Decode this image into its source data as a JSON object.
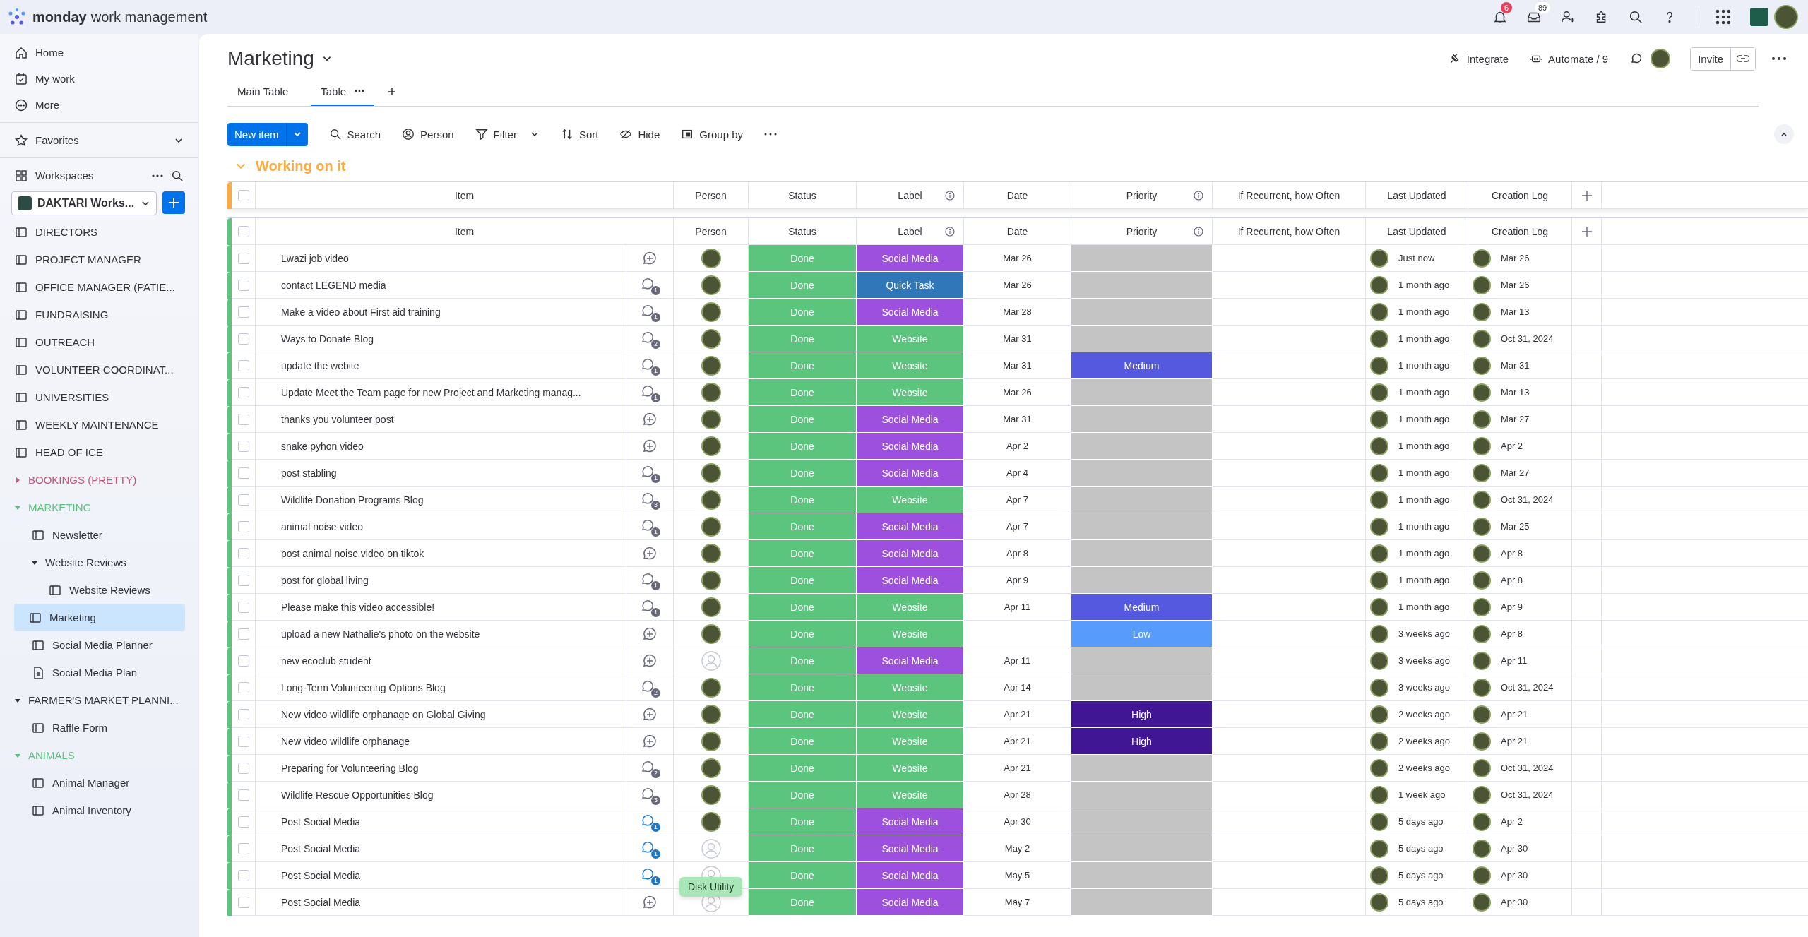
{
  "topbar": {
    "brand": "monday",
    "product": "work management",
    "notifications_badge": "6",
    "inbox_badge": "89"
  },
  "sidebar": {
    "nav": [
      {
        "kind": "home",
        "label": "Home"
      },
      {
        "kind": "my_work",
        "label": "My work"
      },
      {
        "kind": "more",
        "label": "More"
      }
    ],
    "favorites": "Favorites",
    "workspaces": "Workspaces",
    "workspace": "DAKTARI Works...",
    "tree": [
      {
        "kind": "board",
        "label": "DIRECTORS",
        "selected": false
      },
      {
        "kind": "board",
        "label": "PROJECT MANAGER",
        "selected": false
      },
      {
        "kind": "board",
        "label": "OFFICE MANAGER (PATIE...",
        "selected": false
      },
      {
        "kind": "board",
        "label": "FUNDRAISING",
        "selected": false
      },
      {
        "kind": "board",
        "label": "OUTREACH",
        "selected": false
      },
      {
        "kind": "board",
        "label": "VOLUNTEER COORDINAT...",
        "selected": false
      },
      {
        "kind": "board",
        "label": "UNIVERSITIES",
        "selected": false
      },
      {
        "kind": "board",
        "label": "WEEKLY MAINTENANCE",
        "selected": false
      },
      {
        "kind": "board",
        "label": "HEAD OF ICE",
        "selected": false
      },
      {
        "kind": "folder",
        "label": "BOOKINGS (PRETTY)",
        "color": "#c9547a",
        "expanded": false
      },
      {
        "kind": "folder",
        "label": "MARKETING",
        "color": "#5ac47d",
        "expanded": true,
        "children": [
          {
            "kind": "board",
            "label": "Newsletter",
            "selected": false
          },
          {
            "kind": "folder",
            "label": "Website Reviews",
            "color": "#323338",
            "expanded": true,
            "children": [
              {
                "kind": "board",
                "label": "Website Reviews",
                "selected": false
              }
            ]
          },
          {
            "kind": "board",
            "label": "Marketing",
            "selected": true
          },
          {
            "kind": "board",
            "label": "Social Media Planner",
            "selected": false
          },
          {
            "kind": "doc",
            "label": "Social Media Plan",
            "selected": false
          }
        ]
      },
      {
        "kind": "folder",
        "label": "FARMER'S MARKET PLANNI...",
        "color": "#323338",
        "expanded": true,
        "children": [
          {
            "kind": "board",
            "label": "Raffle Form",
            "selected": false
          }
        ]
      },
      {
        "kind": "folder",
        "label": "ANIMALS",
        "color": "#5ac47d",
        "expanded": true,
        "children": [
          {
            "kind": "board",
            "label": "Animal Manager",
            "selected": false
          },
          {
            "kind": "board",
            "label": "Animal Inventory",
            "selected": false
          }
        ]
      }
    ]
  },
  "board": {
    "title": "Marketing",
    "tabs": [
      {
        "label": "Main Table",
        "selected": false
      },
      {
        "label": "Table",
        "selected": true
      }
    ],
    "integrate": "Integrate",
    "automate": "Automate / 9",
    "invite": "Invite"
  },
  "toolbar": {
    "new_item": "New item",
    "tools": [
      {
        "kind": "search",
        "label": "Search"
      },
      {
        "kind": "person",
        "label": "Person"
      },
      {
        "kind": "filter",
        "label": "Filter"
      },
      {
        "kind": "sort",
        "label": "Sort"
      },
      {
        "kind": "hide",
        "label": "Hide"
      },
      {
        "kind": "group",
        "label": "Group by"
      }
    ]
  },
  "groups": [
    {
      "title": "Working on it",
      "color": "#fdab3d",
      "all_checked": false,
      "columns": [
        {
          "title": "Item",
          "info": false
        },
        {
          "title": "Person",
          "info": false
        },
        {
          "title": "Status",
          "info": false
        },
        {
          "title": "Label",
          "info": true
        },
        {
          "title": "Date",
          "info": false
        },
        {
          "title": "Priority",
          "info": true
        },
        {
          "title": "If Recurrent, how Often",
          "info": false
        },
        {
          "title": "Last Updated",
          "info": false
        },
        {
          "title": "Creation Log",
          "info": false
        }
      ]
    },
    {
      "color": "#5bc57e",
      "all_checked": false,
      "columns": [
        {
          "title": "Item",
          "info": false
        },
        {
          "title": "Person",
          "info": false
        },
        {
          "title": "Status",
          "info": false
        },
        {
          "title": "Label",
          "info": true
        },
        {
          "title": "Date",
          "info": false
        },
        {
          "title": "Priority",
          "info": true
        },
        {
          "title": "If Recurrent, how Often",
          "info": false
        },
        {
          "title": "Last Updated",
          "info": false
        },
        {
          "title": "Creation Log",
          "info": false
        }
      ],
      "rows": [
        {
          "checked": false,
          "item": "Lwazi job video",
          "person_assigned": true,
          "status": {
            "text": "Done",
            "color": "#5bc57e"
          },
          "label": {
            "text": "Social Media",
            "color": "#9d50dd"
          },
          "date": "Mar 26",
          "last_updated": "Just now",
          "creation_log": "Mar 26"
        },
        {
          "checked": false,
          "item": "contact LEGEND media",
          "updates": {
            "count": "1",
            "unread": false
          },
          "person_assigned": true,
          "status": {
            "text": "Done",
            "color": "#5bc57e"
          },
          "label": {
            "text": "Quick Task",
            "color": "#2f77b8"
          },
          "date": "Mar 26",
          "last_updated": "1 month ago",
          "creation_log": "Mar 26"
        },
        {
          "checked": false,
          "item": "Make a video about First aid training",
          "updates": {
            "count": "1",
            "unread": false
          },
          "person_assigned": true,
          "status": {
            "text": "Done",
            "color": "#5bc57e"
          },
          "label": {
            "text": "Social Media",
            "color": "#9d50dd"
          },
          "date": "Mar 28",
          "last_updated": "1 month ago",
          "creation_log": "Mar 13"
        },
        {
          "checked": false,
          "item": "Ways to Donate Blog",
          "updates": {
            "count": "2",
            "unread": false
          },
          "person_assigned": true,
          "status": {
            "text": "Done",
            "color": "#5bc57e"
          },
          "label": {
            "text": "Website",
            "color": "#5bc57e"
          },
          "date": "Mar 31",
          "last_updated": "1 month ago",
          "creation_log": "Oct 31, 2024"
        },
        {
          "checked": false,
          "item": "update the webite",
          "updates": {
            "count": "1",
            "unread": false
          },
          "person_assigned": true,
          "status": {
            "text": "Done",
            "color": "#5bc57e"
          },
          "label": {
            "text": "Website",
            "color": "#5bc57e"
          },
          "date": "Mar 31",
          "priority": {
            "text": "Medium",
            "color": "#5559df"
          },
          "last_updated": "1 month ago",
          "creation_log": "Mar 31"
        },
        {
          "checked": false,
          "item": "Update Meet the Team page for new Project and Marketing manag...",
          "updates": {
            "count": "1",
            "unread": false
          },
          "person_assigned": true,
          "status": {
            "text": "Done",
            "color": "#5bc57e"
          },
          "label": {
            "text": "Website",
            "color": "#5bc57e"
          },
          "date": "Mar 26",
          "last_updated": "1 month ago",
          "creation_log": "Mar 13"
        },
        {
          "checked": false,
          "item": "thanks you volunteer post",
          "person_assigned": true,
          "status": {
            "text": "Done",
            "color": "#5bc57e"
          },
          "label": {
            "text": "Social Media",
            "color": "#9d50dd"
          },
          "date": "Mar 31",
          "last_updated": "1 month ago",
          "creation_log": "Mar 27"
        },
        {
          "checked": false,
          "item": "snake pyhon video",
          "person_assigned": true,
          "status": {
            "text": "Done",
            "color": "#5bc57e"
          },
          "label": {
            "text": "Social Media",
            "color": "#9d50dd"
          },
          "date": "Apr 2",
          "last_updated": "1 month ago",
          "creation_log": "Apr 2"
        },
        {
          "checked": false,
          "item": "post stabling",
          "updates": {
            "count": "1",
            "unread": false
          },
          "person_assigned": true,
          "status": {
            "text": "Done",
            "color": "#5bc57e"
          },
          "label": {
            "text": "Social Media",
            "color": "#9d50dd"
          },
          "date": "Apr 4",
          "last_updated": "1 month ago",
          "creation_log": "Mar 27"
        },
        {
          "checked": false,
          "item": "Wildlife Donation Programs Blog",
          "updates": {
            "count": "3",
            "unread": false
          },
          "person_assigned": true,
          "status": {
            "text": "Done",
            "color": "#5bc57e"
          },
          "label": {
            "text": "Website",
            "color": "#5bc57e"
          },
          "date": "Apr 7",
          "last_updated": "1 month ago",
          "creation_log": "Oct 31, 2024"
        },
        {
          "checked": false,
          "item": "animal noise video",
          "updates": {
            "count": "1",
            "unread": false
          },
          "person_assigned": true,
          "status": {
            "text": "Done",
            "color": "#5bc57e"
          },
          "label": {
            "text": "Social Media",
            "color": "#9d50dd"
          },
          "date": "Apr 7",
          "last_updated": "1 month ago",
          "creation_log": "Mar 25"
        },
        {
          "checked": false,
          "item": "post animal noise video on tiktok",
          "person_assigned": true,
          "status": {
            "text": "Done",
            "color": "#5bc57e"
          },
          "label": {
            "text": "Social Media",
            "color": "#9d50dd"
          },
          "date": "Apr 8",
          "last_updated": "1 month ago",
          "creation_log": "Apr 8"
        },
        {
          "checked": false,
          "item": "post for global living",
          "updates": {
            "count": "1",
            "unread": false
          },
          "person_assigned": true,
          "status": {
            "text": "Done",
            "color": "#5bc57e"
          },
          "label": {
            "text": "Social Media",
            "color": "#9d50dd"
          },
          "date": "Apr 9",
          "last_updated": "1 month ago",
          "creation_log": "Apr 8"
        },
        {
          "checked": false,
          "item": "Please make this video accessible!",
          "updates": {
            "count": "1",
            "unread": false
          },
          "person_assigned": true,
          "status": {
            "text": "Done",
            "color": "#5bc57e"
          },
          "label": {
            "text": "Website",
            "color": "#5bc57e"
          },
          "date": "Apr 11",
          "priority": {
            "text": "Medium",
            "color": "#5559df"
          },
          "last_updated": "1 month ago",
          "creation_log": "Apr 9"
        },
        {
          "checked": false,
          "item": "upload a new Nathalie's photo on the website",
          "person_assigned": true,
          "status": {
            "text": "Done",
            "color": "#5bc57e"
          },
          "label": {
            "text": "Website",
            "color": "#5bc57e"
          },
          "priority": {
            "text": "Low",
            "color": "#579bfc"
          },
          "last_updated": "3 weeks ago",
          "creation_log": "Apr 8"
        },
        {
          "checked": false,
          "item": "new ecoclub student",
          "person_assigned": false,
          "status": {
            "text": "Done",
            "color": "#5bc57e"
          },
          "label": {
            "text": "Social Media",
            "color": "#9d50dd"
          },
          "date": "Apr 11",
          "last_updated": "3 weeks ago",
          "creation_log": "Apr 11"
        },
        {
          "checked": false,
          "item": "Long-Term Volunteering Options Blog",
          "updates": {
            "count": "2",
            "unread": false
          },
          "person_assigned": true,
          "status": {
            "text": "Done",
            "color": "#5bc57e"
          },
          "label": {
            "text": "Website",
            "color": "#5bc57e"
          },
          "date": "Apr 14",
          "last_updated": "3 weeks ago",
          "creation_log": "Oct 31, 2024"
        },
        {
          "checked": false,
          "item": "New video wildlife orphanage on Global Giving",
          "person_assigned": true,
          "status": {
            "text": "Done",
            "color": "#5bc57e"
          },
          "label": {
            "text": "Website",
            "color": "#5bc57e"
          },
          "date": "Apr 21",
          "priority": {
            "text": "High",
            "color": "#401694"
          },
          "last_updated": "2 weeks ago",
          "creation_log": "Apr 21"
        },
        {
          "checked": false,
          "item": "New video wildlife orphanage",
          "person_assigned": true,
          "status": {
            "text": "Done",
            "color": "#5bc57e"
          },
          "label": {
            "text": "Website",
            "color": "#5bc57e"
          },
          "date": "Apr 21",
          "priority": {
            "text": "High",
            "color": "#401694"
          },
          "last_updated": "2 weeks ago",
          "creation_log": "Apr 21"
        },
        {
          "checked": false,
          "item": "Preparing for Volunteering Blog",
          "updates": {
            "count": "2",
            "unread": false
          },
          "person_assigned": true,
          "status": {
            "text": "Done",
            "color": "#5bc57e"
          },
          "label": {
            "text": "Website",
            "color": "#5bc57e"
          },
          "date": "Apr 21",
          "last_updated": "2 weeks ago",
          "creation_log": "Oct 31, 2024"
        },
        {
          "checked": false,
          "item": "Wildlife Rescue Opportunities Blog",
          "updates": {
            "count": "3",
            "unread": false
          },
          "person_assigned": true,
          "status": {
            "text": "Done",
            "color": "#5bc57e"
          },
          "label": {
            "text": "Website",
            "color": "#5bc57e"
          },
          "date": "Apr 28",
          "last_updated": "1 week ago",
          "creation_log": "Oct 31, 2024"
        },
        {
          "checked": false,
          "item": "Post Social Media",
          "updates": {
            "count": "1",
            "unread": true
          },
          "person_assigned": true,
          "status": {
            "text": "Done",
            "color": "#5bc57e"
          },
          "label": {
            "text": "Social Media",
            "color": "#9d50dd"
          },
          "date": "Apr 30",
          "last_updated": "5 days ago",
          "creation_log": "Apr 2"
        },
        {
          "checked": false,
          "item": "Post Social Media",
          "updates": {
            "count": "1",
            "unread": true
          },
          "person_assigned": false,
          "status": {
            "text": "Done",
            "color": "#5bc57e"
          },
          "label": {
            "text": "Social Media",
            "color": "#9d50dd"
          },
          "date": "May 2",
          "last_updated": "5 days ago",
          "creation_log": "Apr 30"
        },
        {
          "checked": false,
          "item": "Post Social Media",
          "updates": {
            "count": "1",
            "unread": true
          },
          "person_assigned": false,
          "status": {
            "text": "Done",
            "color": "#5bc57e"
          },
          "label": {
            "text": "Social Media",
            "color": "#9d50dd"
          },
          "date": "May 5",
          "last_updated": "5 days ago",
          "creation_log": "Apr 30"
        },
        {
          "checked": false,
          "item": "Post Social Media",
          "person_assigned": false,
          "status": {
            "text": "Done",
            "color": "#5bc57e"
          },
          "label": {
            "text": "Social Media",
            "color": "#9d50dd"
          },
          "date": "May 7",
          "last_updated": "5 days ago",
          "creation_log": "Apr 30"
        }
      ]
    }
  ],
  "tooltip": "Disk Utility"
}
